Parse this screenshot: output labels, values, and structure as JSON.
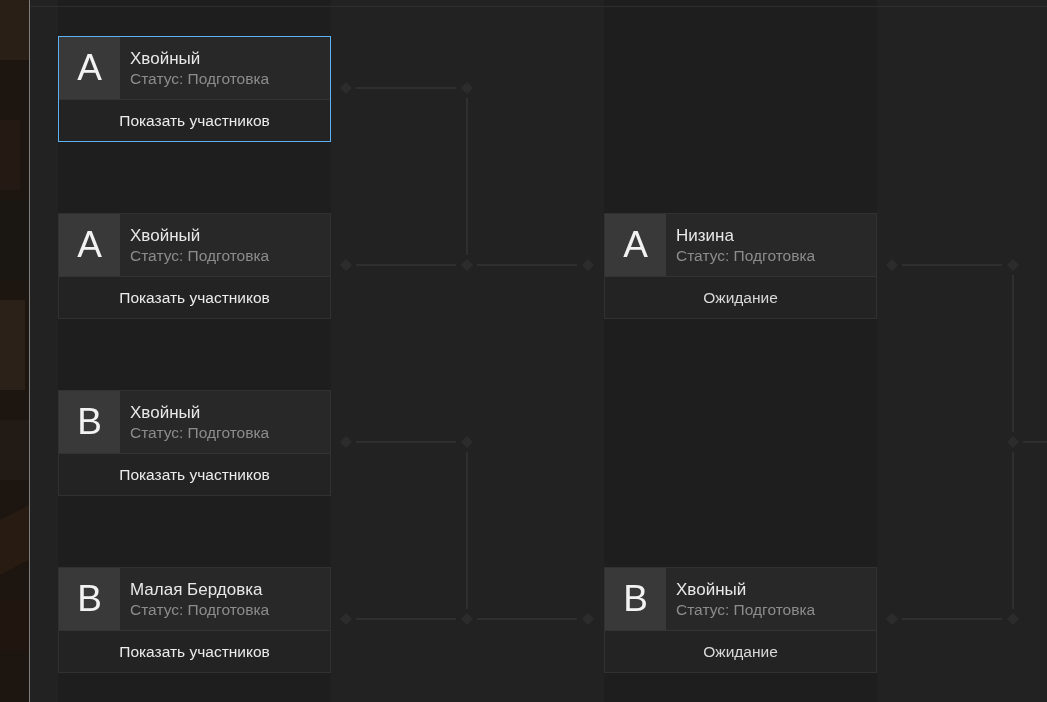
{
  "rounds": [
    {
      "matches": [
        {
          "group": "A",
          "name": "Хвойный",
          "status": "Статус: Подготовка",
          "action": {
            "kind": "button",
            "text": "Показать участников"
          },
          "selected": true
        },
        {
          "group": "A",
          "name": "Хвойный",
          "status": "Статус: Подготовка",
          "action": {
            "kind": "button",
            "text": "Показать участников"
          },
          "selected": false
        },
        {
          "group": "B",
          "name": "Хвойный",
          "status": "Статус: Подготовка",
          "action": {
            "kind": "button",
            "text": "Показать участников"
          },
          "selected": false
        },
        {
          "group": "B",
          "name": "Малая Бердовка",
          "status": "Статус: Подготовка",
          "action": {
            "kind": "button",
            "text": "Показать участников"
          },
          "selected": false
        }
      ]
    },
    {
      "matches": [
        {
          "group": "A",
          "name": "Низина",
          "status": "Статус: Подготовка",
          "action": {
            "kind": "label",
            "text": "Ожидание"
          },
          "selected": false
        },
        {
          "group": "B",
          "name": "Хвойный",
          "status": "Статус: Подготовка",
          "action": {
            "kind": "label",
            "text": "Ожидание"
          },
          "selected": false
        }
      ]
    }
  ]
}
